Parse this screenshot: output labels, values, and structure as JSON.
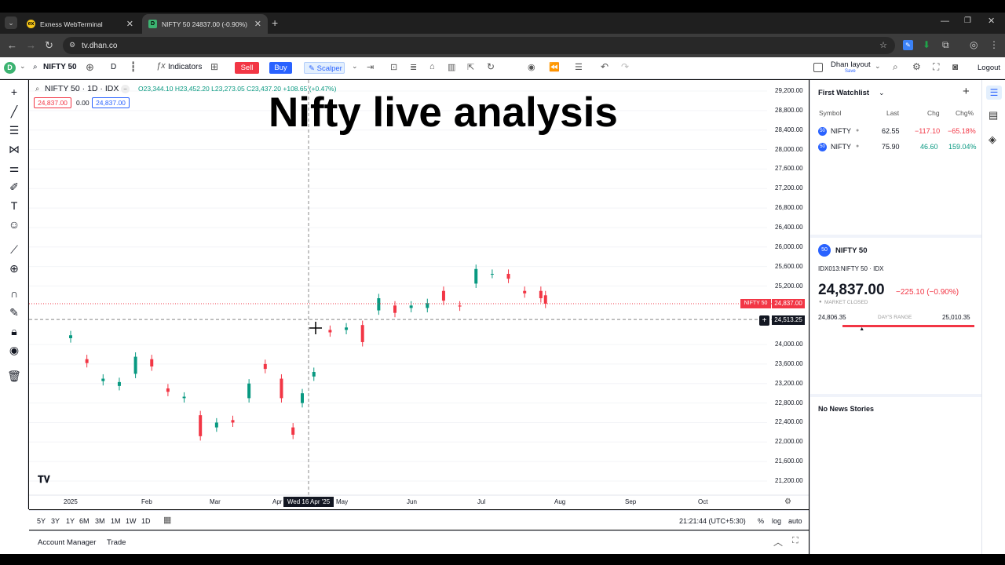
{
  "browser": {
    "tabs": [
      {
        "title": "Exness WebTerminal",
        "active": false
      },
      {
        "title": "NIFTY 50 24837.00 (-0.90%)",
        "active": true
      }
    ],
    "url": "tv.dhan.co"
  },
  "toolbar": {
    "symbol": "NIFTY 50",
    "interval": "D",
    "indicators_label": "Indicators",
    "sell_label": "Sell",
    "buy_label": "Buy",
    "scalper_label": "Scalper",
    "layout_name": "Dhan layout",
    "layout_sub": "Save",
    "logout_label": "Logout"
  },
  "chart": {
    "legend_title": "NIFTY 50 · 1D · IDX",
    "ohlc": {
      "o": "O23,344.10",
      "h": "H23,452.20",
      "l": "L23,273.05",
      "c": "C23,437.20",
      "chg": "+108.65 (+0.47%)"
    },
    "sell_box": "24,837.00",
    "spread": "0.00",
    "buy_box": "24,837.00",
    "overlay_title": "Nifty live analysis",
    "price_ticks": [
      "29,200.00",
      "28,800.00",
      "28,400.00",
      "28,000.00",
      "27,600.00",
      "27,200.00",
      "26,800.00",
      "26,400.00",
      "26,000.00",
      "25,600.00",
      "25,200.00",
      "24,000.00",
      "23,600.00",
      "23,200.00",
      "22,800.00",
      "22,400.00",
      "22,000.00",
      "21,600.00",
      "21,200.00"
    ],
    "last_price_label": "NIFTY 50",
    "last_price": "24,837.00",
    "crosshair_price": "24,513.25",
    "time_ticks": [
      "2025",
      "Feb",
      "Mar",
      "Apr",
      "May",
      "Jun",
      "Jul",
      "Aug",
      "Sep",
      "Oct"
    ],
    "crosshair_date": "Wed 16 Apr '25"
  },
  "chart_data": {
    "type": "candlestick",
    "title": "NIFTY 50 · 1D · IDX",
    "x_range": [
      "2025-01-01",
      "2025-10-15"
    ],
    "ylim": [
      21000,
      29400
    ],
    "series": [
      {
        "name": "NIFTY 50",
        "values": [
          {
            "x": "2025-01-01",
            "o": 24130,
            "c": 24190
          },
          {
            "x": "2025-01-08",
            "o": 23700,
            "c": 23620
          },
          {
            "x": "2025-01-15",
            "o": 23250,
            "c": 23300
          },
          {
            "x": "2025-01-22",
            "o": 23150,
            "c": 23230
          },
          {
            "x": "2025-01-29",
            "o": 23400,
            "c": 23750
          },
          {
            "x": "2025-02-05",
            "o": 23700,
            "c": 23550
          },
          {
            "x": "2025-02-12",
            "o": 23100,
            "c": 23030
          },
          {
            "x": "2025-02-19",
            "o": 22900,
            "c": 22930
          },
          {
            "x": "2025-02-26",
            "o": 22550,
            "c": 22120
          },
          {
            "x": "2025-03-05",
            "o": 22300,
            "c": 22400
          },
          {
            "x": "2025-03-12",
            "o": 22450,
            "c": 22400
          },
          {
            "x": "2025-03-19",
            "o": 22900,
            "c": 23200
          },
          {
            "x": "2025-03-26",
            "o": 23600,
            "c": 23500
          },
          {
            "x": "2025-04-02",
            "o": 23300,
            "c": 22900
          },
          {
            "x": "2025-04-07",
            "o": 22300,
            "c": 22150
          },
          {
            "x": "2025-04-11",
            "o": 22800,
            "c": 23000
          },
          {
            "x": "2025-04-16",
            "o": 23344.1,
            "c": 23437.2
          },
          {
            "x": "2025-04-23",
            "o": 24300,
            "c": 24250
          },
          {
            "x": "2025-04-30",
            "o": 24300,
            "c": 24350
          },
          {
            "x": "2025-05-07",
            "o": 24400,
            "c": 24050
          },
          {
            "x": "2025-05-14",
            "o": 24700,
            "c": 24950
          },
          {
            "x": "2025-05-21",
            "o": 24800,
            "c": 24650
          },
          {
            "x": "2025-05-28",
            "o": 24750,
            "c": 24800
          },
          {
            "x": "2025-06-04",
            "o": 24750,
            "c": 24850
          },
          {
            "x": "2025-06-11",
            "o": 25100,
            "c": 24900
          },
          {
            "x": "2025-06-18",
            "o": 24800,
            "c": 24780
          },
          {
            "x": "2025-06-25",
            "o": 25250,
            "c": 25550
          },
          {
            "x": "2025-07-02",
            "o": 25450,
            "c": 25450
          },
          {
            "x": "2025-07-09",
            "o": 25450,
            "c": 25350
          },
          {
            "x": "2025-07-16",
            "o": 25100,
            "c": 25050
          },
          {
            "x": "2025-07-23",
            "o": 25100,
            "c": 24950
          },
          {
            "x": "2025-07-25",
            "o": 25010,
            "c": 24837
          }
        ]
      }
    ]
  },
  "range_bar": {
    "ranges": [
      "5Y",
      "3Y",
      "1Y",
      "6M",
      "3M",
      "1M",
      "1W",
      "1D"
    ],
    "time": "21:21:44 (UTC+5:30)",
    "pct": "%",
    "log": "log",
    "auto": "auto"
  },
  "account_bar": {
    "account_manager": "Account Manager",
    "trade": "Trade"
  },
  "watchlist": {
    "title": "First Watchlist",
    "columns": [
      "Symbol",
      "Last",
      "Chg",
      "Chg%"
    ],
    "rows": [
      {
        "symbol": "NIFTY",
        "last": "62.55",
        "chg": "−117.10",
        "chgp": "−65.18%",
        "dir": "down"
      },
      {
        "symbol": "NIFTY",
        "last": "75.90",
        "chg": "46.60",
        "chgp": "159.04%",
        "dir": "up"
      }
    ]
  },
  "details": {
    "name": "NIFTY 50",
    "code": "IDX013:NIFTY 50 · IDX",
    "price": "24,837.00",
    "change": "−225.10 (−0.90%)",
    "status": "MARKET CLOSED",
    "range_low": "24,806.35",
    "range_label": "DAY'S RANGE",
    "range_high": "25,010.35",
    "range_fraction": 0.15
  },
  "news": {
    "empty": "No News Stories"
  },
  "colors": {
    "up": "#089981",
    "down": "#f23645",
    "accent": "#2962ff"
  }
}
